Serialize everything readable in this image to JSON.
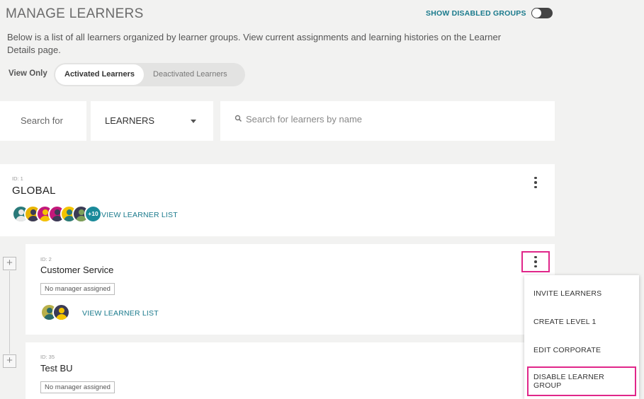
{
  "header": {
    "title": "MANAGE LEARNERS",
    "show_disabled_label": "SHOW DISABLED GROUPS",
    "description": "Below is a list of all learners organized by learner groups. View current assignments and learning histories on the Learner Details page."
  },
  "filter": {
    "view_only_label": "View Only",
    "activated_label": "Activated Learners",
    "deactivated_label": "Deactivated Learners"
  },
  "search": {
    "search_for_label": "Search for",
    "type_value": "LEARNERS",
    "placeholder": "Search for learners by name"
  },
  "groups": [
    {
      "id_label": "ID: 1",
      "name": "GLOBAL",
      "avatar_more": "+10",
      "view_list_label": "VIEW LEARNER LIST"
    },
    {
      "id_label": "ID: 2",
      "name": "Customer Service",
      "manager_label": "No manager assigned",
      "view_list_label": "VIEW LEARNER LIST"
    },
    {
      "id_label": "ID: 35",
      "name": "Test BU",
      "manager_label": "No manager assigned"
    }
  ],
  "context_menu": {
    "items": [
      "INVITE LEARNERS",
      "CREATE LEVEL 1",
      "EDIT CORPORATE",
      "DISABLE LEARNER GROUP"
    ]
  },
  "colors": {
    "accent": "#1a7a8c",
    "highlight": "#e0268a"
  }
}
